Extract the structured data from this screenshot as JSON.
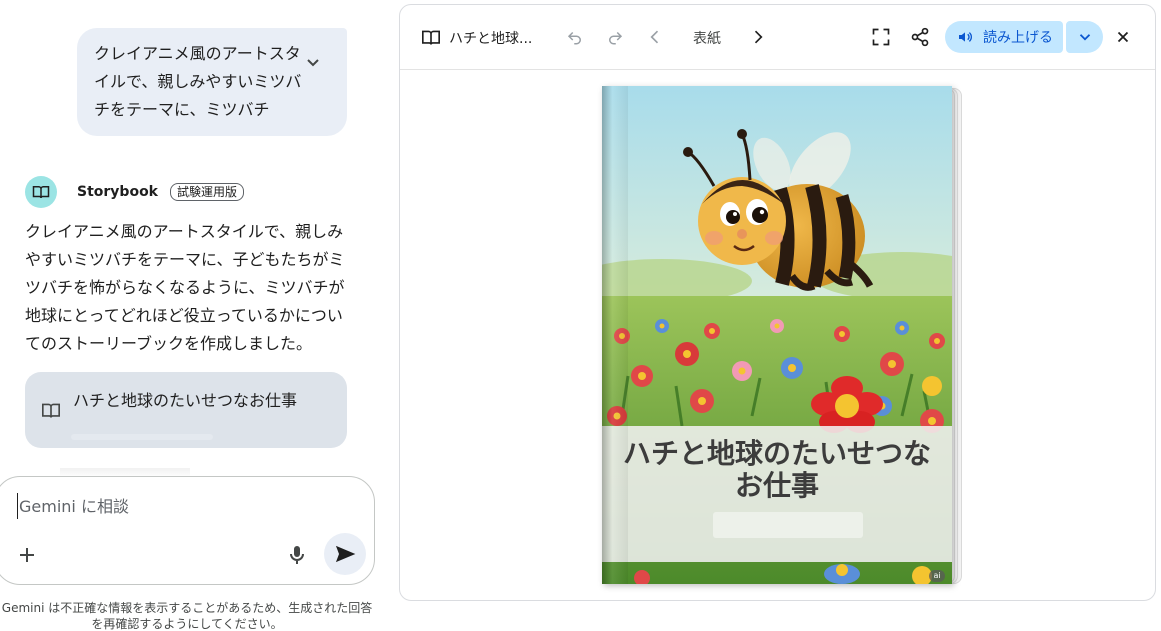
{
  "chat": {
    "user_prompt": "クレイアニメ風のアートスタイルで、親しみやすいミツバチをテーマに、ミツバチ",
    "responder_name": "Storybook",
    "responder_badge": "試験運用版",
    "response_text": "クレイアニメ風のアートスタイルで、親しみやすいミツバチをテーマに、子どもたちがミツバチを怖がらなくなるように、ミツバチが地球にとってどれほど役立っているかについてのストーリーブックを作成しました。",
    "story_card_title": "ハチと地球のたいせつなお仕事",
    "input_placeholder": "Gemini に相談",
    "disclaimer": "Gemini は不正確な情報を表示することがあるため、生成された回答を再確認するようにしてください。"
  },
  "storybook": {
    "title_short": "ハチと地球...",
    "page_label": "表紙",
    "read_aloud_label": "読み上げる",
    "cover_title": "ハチと地球のたいせつなお仕事",
    "ai_mark": "ai"
  },
  "icons": {
    "expand": "chevron-down-icon",
    "avatar": "book-icon",
    "story_card": "book-icon",
    "add": "plus-icon",
    "mic": "mic-icon",
    "send": "send-icon",
    "toolbar_book": "book-icon",
    "undo": "undo-icon",
    "redo": "redo-icon",
    "prev": "chevron-left-icon",
    "next": "chevron-right-icon",
    "fullscreen": "fullscreen-icon",
    "share": "share-icon",
    "volume": "volume-icon",
    "dropdown": "chevron-down-icon",
    "close": "close-icon"
  },
  "colors": {
    "user_bubble": "#e9eef6",
    "avatar_bg": "#9be4e4",
    "story_card_bg": "#dde3ea",
    "read_button_bg": "#c2e7ff",
    "read_button_text": "#0b57d0"
  }
}
